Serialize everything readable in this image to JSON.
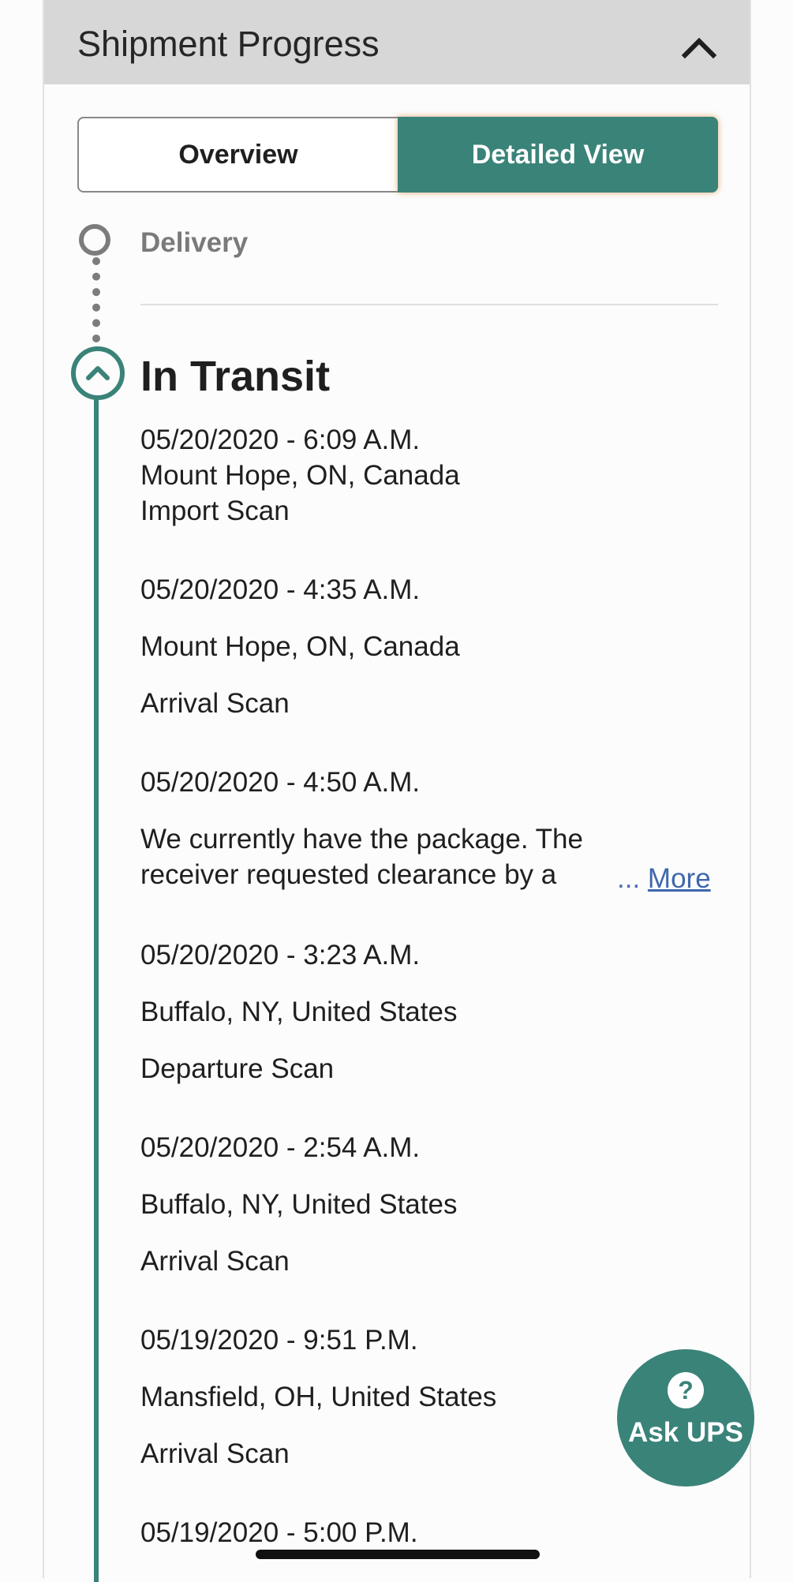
{
  "header": {
    "title": "Shipment Progress",
    "collapse_icon": "chevron-up-icon"
  },
  "view_toggle": {
    "overview_label": "Overview",
    "detailed_label": "Detailed View",
    "selected": "Detailed View",
    "accent_color": "#3a8379"
  },
  "timeline": {
    "delivery_label": "Delivery",
    "in_transit_label": "In Transit",
    "events": [
      {
        "datetime": "05/20/2020 - 6:09 A.M.",
        "location": "Mount Hope, ON, Canada",
        "activity": "Import Scan"
      },
      {
        "datetime": "05/20/2020 - 4:35 A.M.",
        "location": "Mount Hope, ON, Canada",
        "activity": "Arrival Scan"
      },
      {
        "datetime": "05/20/2020 - 4:50 A.M.",
        "message_line1": "We currently have the package. The",
        "message_line2": "receiver requested clearance by a",
        "ellipsis": "...",
        "more_label": "More"
      },
      {
        "datetime": "05/20/2020 - 3:23 A.M.",
        "location": "Buffalo, NY, United States",
        "activity": "Departure Scan"
      },
      {
        "datetime": "05/20/2020 - 2:54 A.M.",
        "location": "Buffalo, NY, United States",
        "activity": "Arrival Scan"
      },
      {
        "datetime": "05/19/2020 - 9:51 P.M.",
        "location": "Mansfield, OH, United States",
        "activity": "Arrival Scan"
      },
      {
        "datetime": "05/19/2020 - 5:00 P.M."
      }
    ]
  },
  "ask_ups": {
    "label": "Ask UPS",
    "icon": "question-icon"
  }
}
